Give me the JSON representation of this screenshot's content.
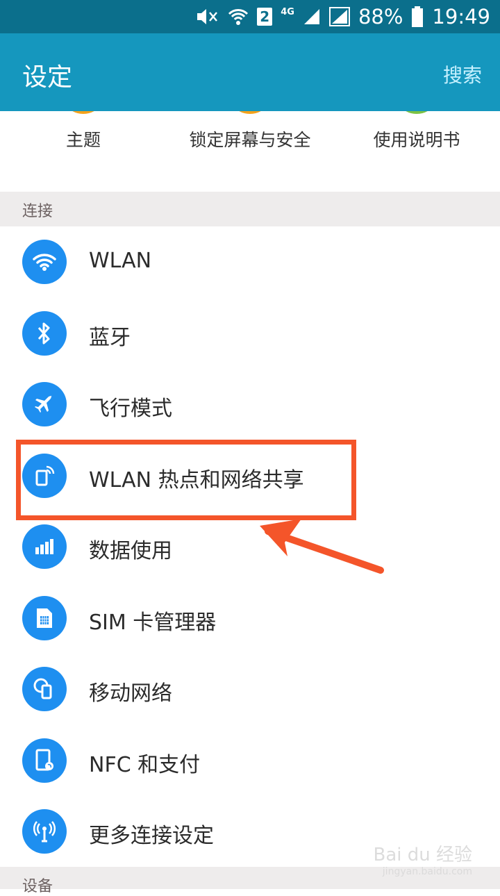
{
  "status_bar": {
    "sim_slot": "2",
    "network_type": "4G",
    "battery": "88%",
    "time": "19:49"
  },
  "app_bar": {
    "title": "设定",
    "search_label": "搜索"
  },
  "quick_settings": [
    {
      "label": "主题",
      "ring_color": "#f4a21c"
    },
    {
      "label": "锁定屏幕与安全",
      "ring_color": "#f4a21c"
    },
    {
      "label": "使用说明书",
      "ring_color": "#7cc243"
    }
  ],
  "sections": {
    "connections": "连接",
    "device": "设备"
  },
  "connections": [
    {
      "label": "WLAN",
      "icon": "wifi-icon"
    },
    {
      "label": "蓝牙",
      "icon": "bluetooth-icon"
    },
    {
      "label": "飞行模式",
      "icon": "airplane-icon"
    },
    {
      "label": "WLAN 热点和网络共享",
      "icon": "hotspot-icon"
    },
    {
      "label": "数据使用",
      "icon": "data-usage-icon"
    },
    {
      "label": "SIM 卡管理器",
      "icon": "sim-card-icon"
    },
    {
      "label": "移动网络",
      "icon": "mobile-network-icon"
    },
    {
      "label": "NFC 和支付",
      "icon": "nfc-icon"
    },
    {
      "label": "更多连接设定",
      "icon": "more-connections-icon"
    }
  ],
  "colors": {
    "status_bar": "#0b6f8c",
    "app_bar": "#1597be",
    "icon_circle": "#1e8ff0",
    "annotation": "#f4552a"
  },
  "watermark": {
    "brand": "Bai du 经验",
    "url": "jingyan.baidu.com"
  }
}
